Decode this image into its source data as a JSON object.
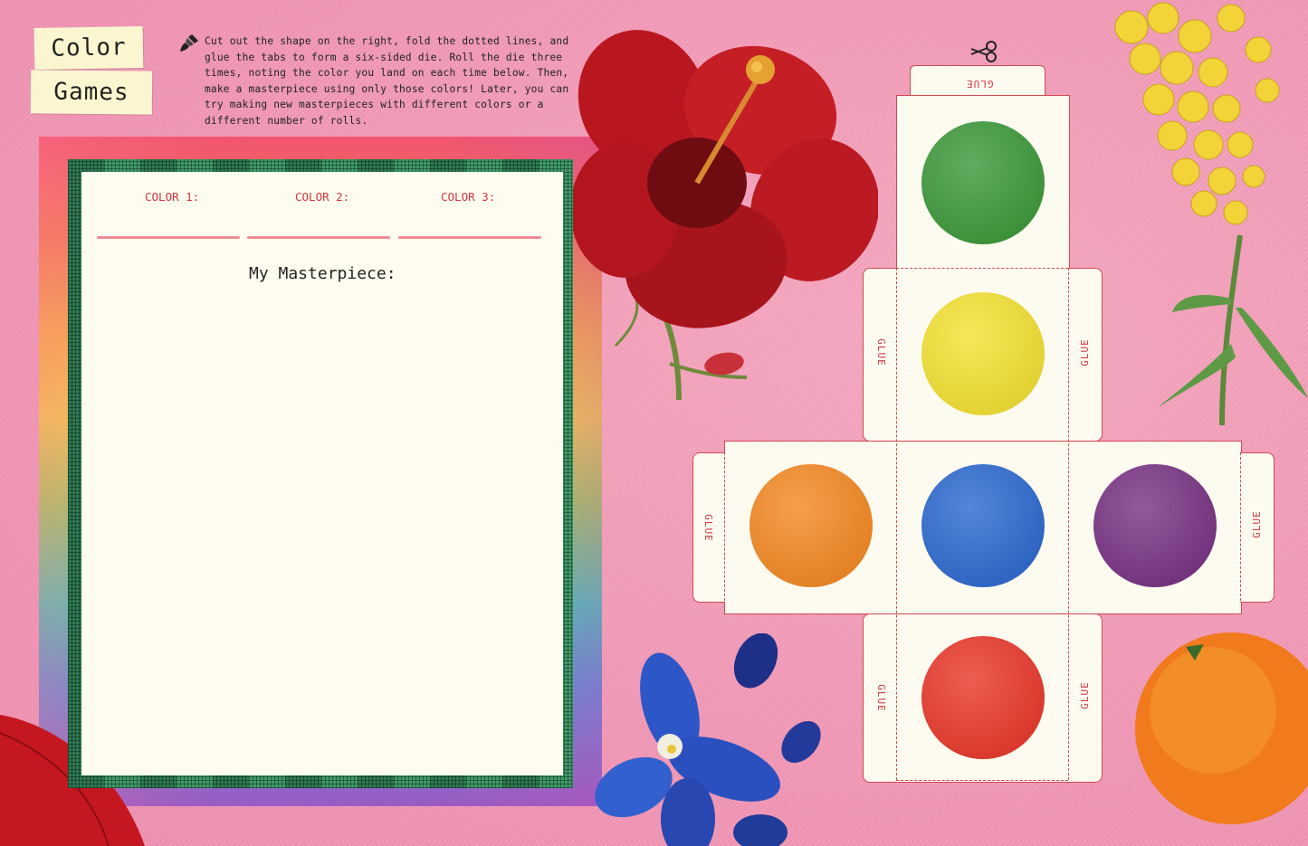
{
  "page": {
    "title_line1": "Color",
    "title_line2": "Games",
    "instructions": "Cut out the shape on the right, fold the dotted lines, and glue the tabs to form a six-sided die. Roll the die three times, noting the color you land on each time below. Then, make a masterpiece using only those colors! Later, you can try making new masterpieces with different colors or a different number of rolls."
  },
  "worksheet": {
    "color1_label": "COLOR 1:",
    "color2_label": "COLOR 2:",
    "color3_label": "COLOR 3:",
    "masterpiece_label": "My Masterpiece:"
  },
  "die": {
    "glue_label": "GLUE",
    "faces": [
      {
        "name": "green",
        "color": "#3f9a3c"
      },
      {
        "name": "yellow",
        "color": "#f4e234"
      },
      {
        "name": "orange",
        "color": "#f58a25"
      },
      {
        "name": "blue",
        "color": "#2f6bd1"
      },
      {
        "name": "purple",
        "color": "#7a3585"
      },
      {
        "name": "red",
        "color": "#ea3a2c"
      }
    ],
    "line_color": "#d04a50"
  },
  "decorations": {
    "icons": [
      "paintbrush-icon",
      "scissors-icon"
    ],
    "illustrations": [
      "red-hibiscus",
      "yellow-wallflower",
      "blue-delphinium",
      "orange-fruit",
      "red-petal"
    ]
  }
}
